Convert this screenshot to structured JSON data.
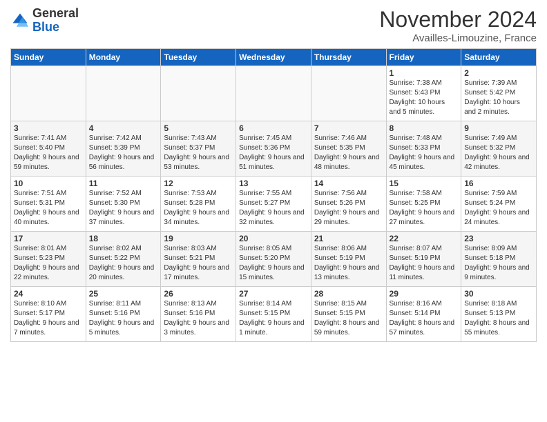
{
  "logo": {
    "general": "General",
    "blue": "Blue"
  },
  "header": {
    "month": "November 2024",
    "location": "Availles-Limouzine, France"
  },
  "weekdays": [
    "Sunday",
    "Monday",
    "Tuesday",
    "Wednesday",
    "Thursday",
    "Friday",
    "Saturday"
  ],
  "weeks": [
    [
      {
        "day": "",
        "info": ""
      },
      {
        "day": "",
        "info": ""
      },
      {
        "day": "",
        "info": ""
      },
      {
        "day": "",
        "info": ""
      },
      {
        "day": "",
        "info": ""
      },
      {
        "day": "1",
        "info": "Sunrise: 7:38 AM\nSunset: 5:43 PM\nDaylight: 10 hours and 5 minutes."
      },
      {
        "day": "2",
        "info": "Sunrise: 7:39 AM\nSunset: 5:42 PM\nDaylight: 10 hours and 2 minutes."
      }
    ],
    [
      {
        "day": "3",
        "info": "Sunrise: 7:41 AM\nSunset: 5:40 PM\nDaylight: 9 hours and 59 minutes."
      },
      {
        "day": "4",
        "info": "Sunrise: 7:42 AM\nSunset: 5:39 PM\nDaylight: 9 hours and 56 minutes."
      },
      {
        "day": "5",
        "info": "Sunrise: 7:43 AM\nSunset: 5:37 PM\nDaylight: 9 hours and 53 minutes."
      },
      {
        "day": "6",
        "info": "Sunrise: 7:45 AM\nSunset: 5:36 PM\nDaylight: 9 hours and 51 minutes."
      },
      {
        "day": "7",
        "info": "Sunrise: 7:46 AM\nSunset: 5:35 PM\nDaylight: 9 hours and 48 minutes."
      },
      {
        "day": "8",
        "info": "Sunrise: 7:48 AM\nSunset: 5:33 PM\nDaylight: 9 hours and 45 minutes."
      },
      {
        "day": "9",
        "info": "Sunrise: 7:49 AM\nSunset: 5:32 PM\nDaylight: 9 hours and 42 minutes."
      }
    ],
    [
      {
        "day": "10",
        "info": "Sunrise: 7:51 AM\nSunset: 5:31 PM\nDaylight: 9 hours and 40 minutes."
      },
      {
        "day": "11",
        "info": "Sunrise: 7:52 AM\nSunset: 5:30 PM\nDaylight: 9 hours and 37 minutes."
      },
      {
        "day": "12",
        "info": "Sunrise: 7:53 AM\nSunset: 5:28 PM\nDaylight: 9 hours and 34 minutes."
      },
      {
        "day": "13",
        "info": "Sunrise: 7:55 AM\nSunset: 5:27 PM\nDaylight: 9 hours and 32 minutes."
      },
      {
        "day": "14",
        "info": "Sunrise: 7:56 AM\nSunset: 5:26 PM\nDaylight: 9 hours and 29 minutes."
      },
      {
        "day": "15",
        "info": "Sunrise: 7:58 AM\nSunset: 5:25 PM\nDaylight: 9 hours and 27 minutes."
      },
      {
        "day": "16",
        "info": "Sunrise: 7:59 AM\nSunset: 5:24 PM\nDaylight: 9 hours and 24 minutes."
      }
    ],
    [
      {
        "day": "17",
        "info": "Sunrise: 8:01 AM\nSunset: 5:23 PM\nDaylight: 9 hours and 22 minutes."
      },
      {
        "day": "18",
        "info": "Sunrise: 8:02 AM\nSunset: 5:22 PM\nDaylight: 9 hours and 20 minutes."
      },
      {
        "day": "19",
        "info": "Sunrise: 8:03 AM\nSunset: 5:21 PM\nDaylight: 9 hours and 17 minutes."
      },
      {
        "day": "20",
        "info": "Sunrise: 8:05 AM\nSunset: 5:20 PM\nDaylight: 9 hours and 15 minutes."
      },
      {
        "day": "21",
        "info": "Sunrise: 8:06 AM\nSunset: 5:19 PM\nDaylight: 9 hours and 13 minutes."
      },
      {
        "day": "22",
        "info": "Sunrise: 8:07 AM\nSunset: 5:19 PM\nDaylight: 9 hours and 11 minutes."
      },
      {
        "day": "23",
        "info": "Sunrise: 8:09 AM\nSunset: 5:18 PM\nDaylight: 9 hours and 9 minutes."
      }
    ],
    [
      {
        "day": "24",
        "info": "Sunrise: 8:10 AM\nSunset: 5:17 PM\nDaylight: 9 hours and 7 minutes."
      },
      {
        "day": "25",
        "info": "Sunrise: 8:11 AM\nSunset: 5:16 PM\nDaylight: 9 hours and 5 minutes."
      },
      {
        "day": "26",
        "info": "Sunrise: 8:13 AM\nSunset: 5:16 PM\nDaylight: 9 hours and 3 minutes."
      },
      {
        "day": "27",
        "info": "Sunrise: 8:14 AM\nSunset: 5:15 PM\nDaylight: 9 hours and 1 minute."
      },
      {
        "day": "28",
        "info": "Sunrise: 8:15 AM\nSunset: 5:15 PM\nDaylight: 8 hours and 59 minutes."
      },
      {
        "day": "29",
        "info": "Sunrise: 8:16 AM\nSunset: 5:14 PM\nDaylight: 8 hours and 57 minutes."
      },
      {
        "day": "30",
        "info": "Sunrise: 8:18 AM\nSunset: 5:13 PM\nDaylight: 8 hours and 55 minutes."
      }
    ]
  ]
}
